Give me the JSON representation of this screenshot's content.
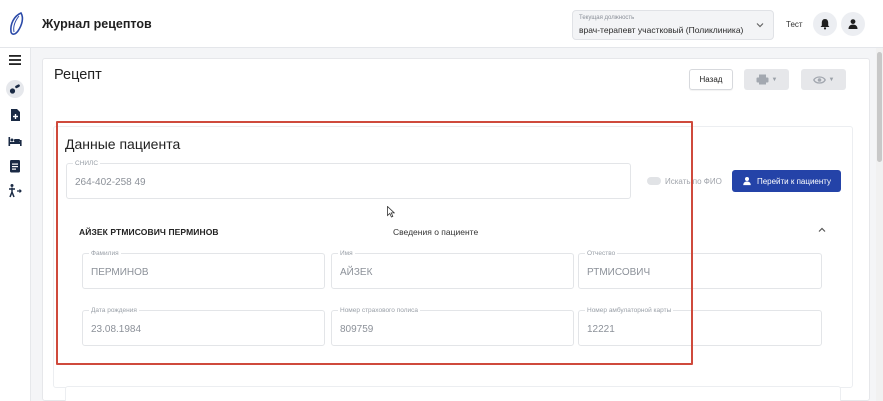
{
  "header": {
    "app_title": "Журнал рецептов",
    "role_caption": "Текущая должность",
    "role_value": "врач-терапевт участковый (Поликлиника)",
    "user_name": "Тест"
  },
  "sidebar": {
    "icons": [
      "menu-icon",
      "pills-icon",
      "document-plus-icon",
      "bed-icon",
      "clipboard-icon",
      "accessibility-icon"
    ]
  },
  "page": {
    "title": "Рецепт",
    "back_label": "Назад"
  },
  "patient_section": {
    "title": "Данные пациента",
    "snils_label": "СНИЛС",
    "snils_value": "264-402-258 49",
    "search_by_name_label": "Искать по ФИО",
    "go_to_patient_label": "Перейти к пациенту",
    "patient_full_name": "АЙЗЕК РТМИСОВИЧ ПЕРМИНОВ",
    "patient_info_label": "Сведения о пациенте",
    "fields": {
      "last_name": {
        "label": "Фамилия",
        "value": "ПЕРМИНОВ"
      },
      "first_name": {
        "label": "Имя",
        "value": "АЙЗЕК"
      },
      "patronymic": {
        "label": "Отчество",
        "value": "РТМИСОВИЧ"
      },
      "birth_date": {
        "label": "Дата рождения",
        "value": "23.08.1984"
      },
      "insurance_number": {
        "label": "Номер страхового полиса",
        "value": "809759"
      },
      "outpatient_card": {
        "label": "Номер амбулаторной карты",
        "value": "12221"
      }
    }
  },
  "colors": {
    "primary": "#2443a8",
    "highlight": "#cf4a3c"
  }
}
